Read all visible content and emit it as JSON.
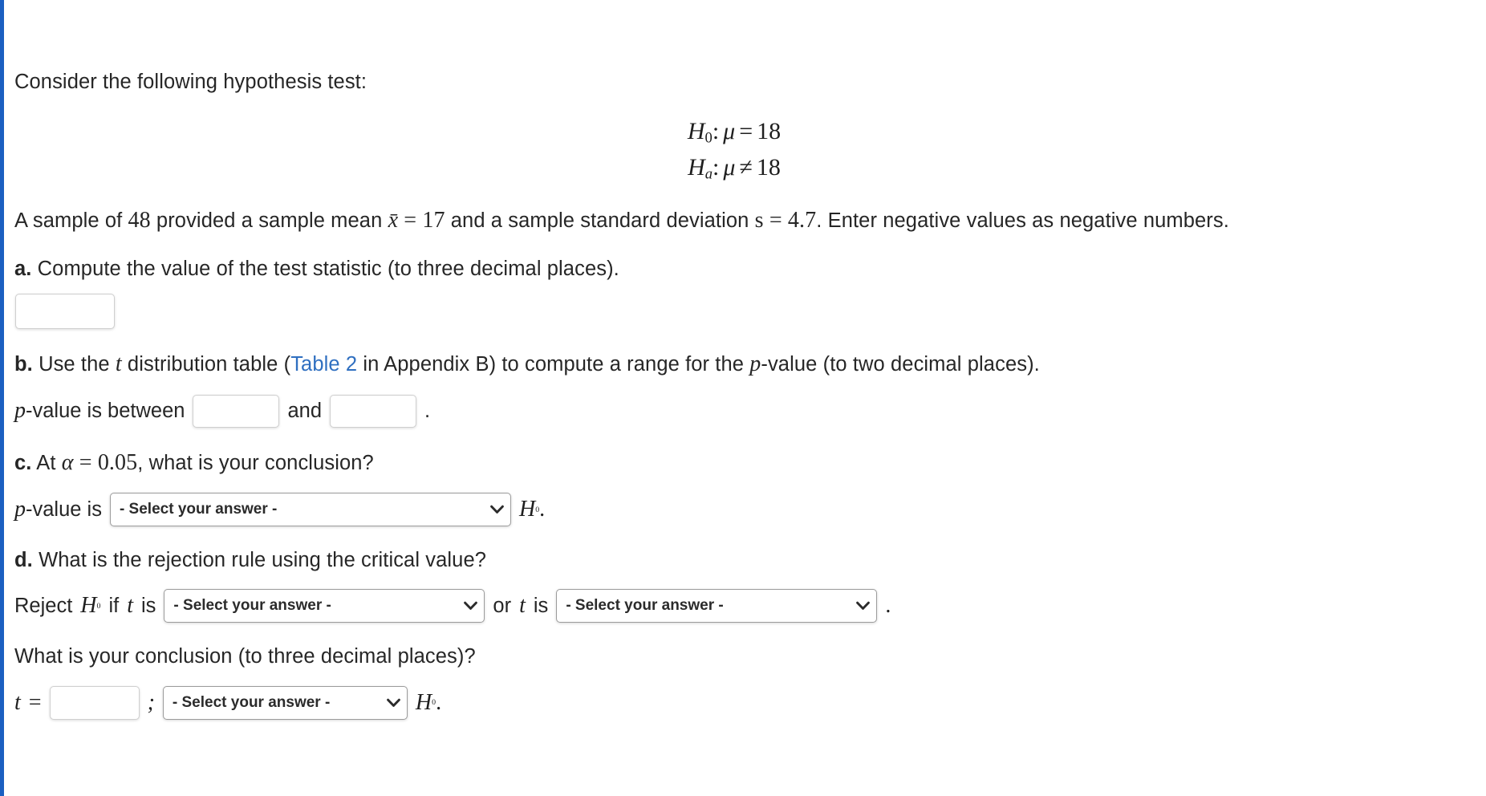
{
  "intro": {
    "text": "Consider the following hypothesis test:"
  },
  "hypotheses": {
    "null": {
      "symbol": "H",
      "sub": "0",
      "relation": ":",
      "param": "μ",
      "operator": "=",
      "value": "18"
    },
    "alt": {
      "symbol": "H",
      "sub": "a",
      "relation": ":",
      "param": "μ",
      "operator": "≠",
      "value": "18"
    }
  },
  "sample": {
    "prefix": "A sample of",
    "n": "48",
    "mid": "provided a sample mean",
    "xbar_symbol": "x̄",
    "xbar_eq": "=",
    "xbar_value": "17",
    "mid2": "and a sample standard deviation",
    "s_symbol": "s",
    "s_eq": "=",
    "s_value": "4.7",
    "suffix": ". Enter negative values as negative numbers."
  },
  "parts": {
    "a": {
      "label": "a.",
      "text": "Compute the value of the test statistic (to three decimal places).",
      "input_value": "",
      "input_placeholder": ""
    },
    "b": {
      "label": "b.",
      "text_before_t": "Use the",
      "t_symbol": "t",
      "text_after_t": "distribution table (",
      "link_text": "Table 2",
      "text_after_link": "in Appendix B) to compute a range for the",
      "p_symbol": "p",
      "text_end": "-value (to two decimal places).",
      "range_prefix_p": "p",
      "range_prefix": "-value is between",
      "range_join": "and",
      "range_end": ".",
      "lower_value": "",
      "upper_value": ""
    },
    "c": {
      "label": "c.",
      "text_at": "At",
      "alpha_symbol": "α",
      "alpha_eq": "=",
      "alpha_value": "0.05",
      "text_end": ", what is your conclusion?",
      "row_prefix_p": "p",
      "row_prefix": "-value is",
      "select_value": "- Select your answer -",
      "h_symbol": "H",
      "h_sub": "0",
      "row_end": "."
    },
    "d": {
      "label": "d.",
      "text": "What is the rejection rule using the critical value?",
      "reject_text": "Reject",
      "h_symbol": "H",
      "h_sub": "0",
      "if_text": "if",
      "t_symbol": "t",
      "is_text": "is",
      "select1_value": "- Select your answer -",
      "or_text": "or",
      "t_symbol2": "t",
      "is_text2": "is",
      "select2_value": "- Select your answer -",
      "row_end": "."
    },
    "e": {
      "question": "What is your conclusion (to three decimal places)?",
      "t_symbol": "t",
      "t_eq": "=",
      "t_value": "",
      "semicolon": ";",
      "select_value": "- Select your answer -",
      "h_symbol": "H",
      "h_sub": "0",
      "row_end": "."
    }
  },
  "icons": {
    "chevron_down": "chevron-down-icon"
  },
  "colors": {
    "accent_border": "#1b5fc1",
    "link": "#2f6fc0",
    "text": "#262626",
    "input_border": "#cfcfcf",
    "select_border": "#9c9c9c"
  }
}
